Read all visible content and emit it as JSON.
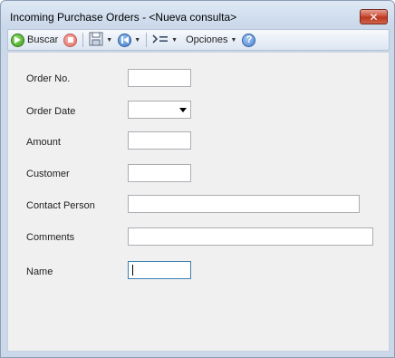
{
  "window": {
    "title": "Incoming Purchase Orders - <Nueva consulta>"
  },
  "toolbar": {
    "search_label": "Buscar",
    "options_label": "Opciones",
    "icons": [
      "go-icon",
      "stop-icon",
      "save-icon",
      "first-record-icon",
      "goto-icon",
      "help-icon"
    ]
  },
  "form": {
    "fields": [
      {
        "label": "Order No.",
        "value": ""
      },
      {
        "label": "Order Date",
        "value": ""
      },
      {
        "label": "Amount",
        "value": ""
      },
      {
        "label": "Customer",
        "value": ""
      },
      {
        "label": "Contact Person",
        "value": ""
      },
      {
        "label": "Comments",
        "value": ""
      },
      {
        "label": "Name",
        "value": ""
      }
    ]
  },
  "colors": {
    "title_gradient_top": "#dfe9f5",
    "client_background": "#f0f0f0",
    "close_button": "#c8472f",
    "focus_border": "#3c7fb1"
  }
}
